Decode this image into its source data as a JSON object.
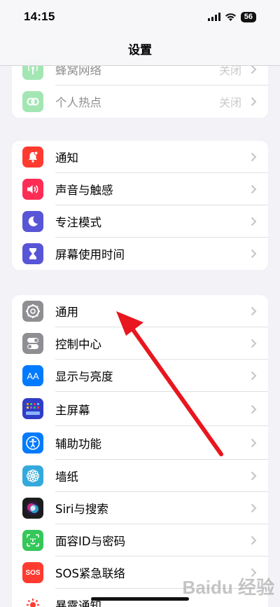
{
  "status": {
    "time": "14:15",
    "battery": "56"
  },
  "nav": {
    "title": "设置"
  },
  "group_top": [
    {
      "label": "蜂窝网络",
      "value": "关闭",
      "icon": "antenna-icon",
      "color": "#34c759"
    },
    {
      "label": "个人热点",
      "value": "关闭",
      "icon": "hotspot-icon",
      "color": "#34c759"
    }
  ],
  "group_mid": [
    {
      "label": "通知",
      "icon": "bell-icon",
      "color": "#ff3b30"
    },
    {
      "label": "声音与触感",
      "icon": "speaker-icon",
      "color": "#ff2d55"
    },
    {
      "label": "专注模式",
      "icon": "moon-icon",
      "color": "#5856d6"
    },
    {
      "label": "屏幕使用时间",
      "icon": "hourglass-icon",
      "color": "#5856d6"
    }
  ],
  "group_bottom": [
    {
      "label": "通用",
      "icon": "gear-icon",
      "color": "#8e8e93"
    },
    {
      "label": "控制中心",
      "icon": "toggles-icon",
      "color": "#8e8e93"
    },
    {
      "label": "显示与亮度",
      "icon": "text-size-icon",
      "color": "#007aff"
    },
    {
      "label": "主屏幕",
      "icon": "home-grid-icon",
      "color": "#3a4bd8"
    },
    {
      "label": "辅助功能",
      "icon": "accessibility-icon",
      "color": "#007aff"
    },
    {
      "label": "墙纸",
      "icon": "wallpaper-flower-icon",
      "color": "#34aadc"
    },
    {
      "label": "Siri与搜索",
      "icon": "siri-icon",
      "color": "#222222"
    },
    {
      "label": "面容ID与密码",
      "icon": "face-id-icon",
      "color": "#34c759"
    },
    {
      "label": "SOS紧急联络",
      "icon": "sos-icon",
      "color": "#ff3b30"
    },
    {
      "label": "暴露通知",
      "icon": "exposure-icon",
      "color": "#ffffff"
    }
  ],
  "sos_icon_text": "SOS",
  "text_size_icon_text": "AA",
  "watermark": "Baidu 经验",
  "annotation": {
    "arrow_color": "#e8161e",
    "target": "通用"
  }
}
